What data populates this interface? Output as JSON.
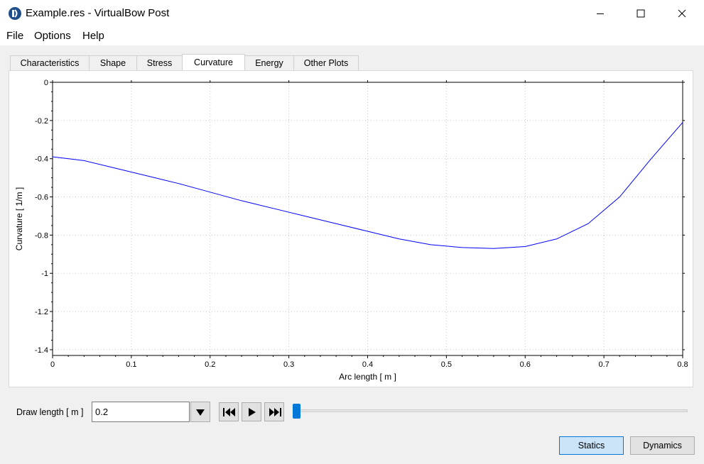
{
  "window": {
    "title": "Example.res - VirtualBow Post"
  },
  "menu": [
    "File",
    "Options",
    "Help"
  ],
  "tabs": [
    "Characteristics",
    "Shape",
    "Stress",
    "Curvature",
    "Energy",
    "Other Plots"
  ],
  "active_tab": "Curvature",
  "controls": {
    "draw_length_label": "Draw length [ m ]",
    "draw_length_value": "0.2",
    "slider_fraction": 0.0,
    "statics_label": "Statics",
    "dynamics_label": "Dynamics"
  },
  "icons": {
    "app": "virtualbow-logo-icon",
    "minimize": "minimize-icon",
    "maximize": "maximize-icon",
    "close": "close-icon",
    "dropdown": "dropdown-arrow-icon",
    "first": "skip-to-start-icon",
    "play": "play-icon",
    "last": "skip-to-end-icon"
  },
  "colors": {
    "line": "#0000ff",
    "accent": "#0078d7",
    "selected_button": "#cce4f7"
  },
  "chart_data": {
    "type": "line",
    "xlabel": "Arc length [ m ]",
    "ylabel": "Curvature [ 1/m ]",
    "xlim": [
      0,
      0.8
    ],
    "ylim": [
      -1.43,
      0
    ],
    "x_ticks": [
      0,
      0.1,
      0.2,
      0.3,
      0.4,
      0.5,
      0.6,
      0.7,
      0.8
    ],
    "x_tick_labels": [
      "0",
      "0.1",
      "0.2",
      "0.3",
      "0.4",
      "0.5",
      "0.6",
      "0.7",
      "0.8"
    ],
    "y_ticks": [
      0,
      -0.2,
      -0.4,
      -0.6,
      -0.8,
      -1,
      -1.2,
      -1.4
    ],
    "y_tick_labels": [
      "0",
      "-0.2",
      "-0.4",
      "-0.6",
      "-0.8",
      "-1",
      "-1.2",
      "-1.4"
    ],
    "grid": true,
    "series": [
      {
        "x": [
          0,
          0.04,
          0.08,
          0.12,
          0.16,
          0.2,
          0.24,
          0.28,
          0.32,
          0.36,
          0.4,
          0.44,
          0.48,
          0.52,
          0.56,
          0.6,
          0.64,
          0.68,
          0.72,
          0.76,
          0.8
        ],
        "y": [
          -0.39,
          -0.41,
          -0.45,
          -0.49,
          -0.53,
          -0.575,
          -0.62,
          -0.66,
          -0.7,
          -0.74,
          -0.78,
          -0.82,
          -0.85,
          -0.865,
          -0.87,
          -0.86,
          -0.82,
          -0.74,
          -0.6,
          -0.4,
          -0.21
        ]
      }
    ]
  }
}
